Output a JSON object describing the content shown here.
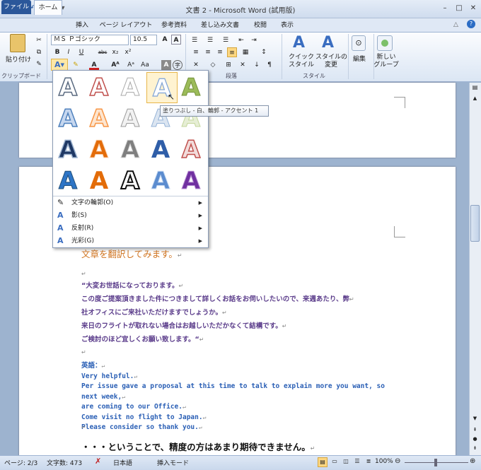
{
  "window": {
    "title": "文書 2 - Microsoft Word (試用版)",
    "app_icon": "W",
    "controls": {
      "minimize": "–",
      "maximize": "□",
      "close": "✕"
    }
  },
  "tabs": [
    "ファイル",
    "ホーム",
    "挿入",
    "ページ レイアウト",
    "参考資料",
    "差し込み文書",
    "校閲",
    "表示"
  ],
  "ribbon": {
    "clipboard": {
      "paste_label": "貼り付け",
      "group_label": "クリップボード"
    },
    "font": {
      "name": "ＭＳ Ｐゴシック",
      "size": "10.5"
    },
    "paragraph_label": "段落",
    "styles": {
      "quick": "クイック\nスタイル",
      "change": "スタイルの\n変更",
      "group_label": "スタイル"
    },
    "edit_label": "編集",
    "new_group_label": "新しい\nグループ"
  },
  "gallery": {
    "letter": "A",
    "tooltip": "塗りつぶし - 白、輪郭 - アクセント 1",
    "menu": [
      {
        "label": "文字の輪郭(O)",
        "icon": "outline-icon"
      },
      {
        "label": "影(S)",
        "icon": "shadow-icon"
      },
      {
        "label": "反射(R)",
        "icon": "reflection-icon"
      },
      {
        "label": "光彩(G)",
        "icon": "glow-icon"
      }
    ]
  },
  "document": {
    "heading": "文章を翻訳してみます。",
    "jp_lines": [
      "“大変お世話になっております。",
      "この度ご提案頂きました件につきまして詳しくお話をお伺いしたいので、来週あたり、弊",
      "社オフィスにご来社いただけますでしょうか。",
      "来日のフライトが取れない場合はお越しいただかなくて結構です。",
      "ご検討のほど宜しくお願い致します。“"
    ],
    "en_header": "英語：",
    "en_lines": [
      "Very helpful.",
      "Per issue gave a proposal at this time to talk to explain more you want, so next week,",
      "are coming to our Office.",
      "Come visit no flight to Japan.",
      "Please consider so thank you."
    ],
    "footer_line": "・・・ということで、精度の方はあまり期待できません。"
  },
  "status": {
    "page": "ページ: 2/3",
    "words": "文字数: 473",
    "language": "日本語",
    "mode": "挿入モード",
    "zoom": "100%"
  }
}
